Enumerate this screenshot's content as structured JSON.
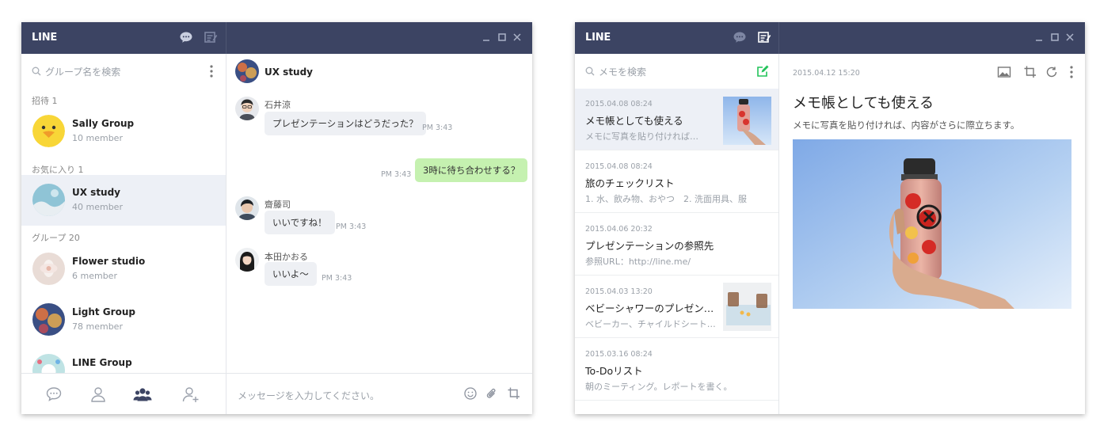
{
  "chat_window": {
    "logo": "LINE",
    "icons": [
      "chat-icon",
      "memo-icon",
      "minimize-icon",
      "maximize-icon",
      "close-icon"
    ],
    "search_placeholder": "グループ名を検索",
    "sections": {
      "invite": "招待 1",
      "favorites": "お気に入り 1",
      "groups": "グループ 20"
    },
    "friends": [
      {
        "name": "Sally Group",
        "sub": "10 member"
      },
      {
        "name": "UX study",
        "sub": "40 member"
      },
      {
        "name": "Flower studio",
        "sub": "6 member"
      },
      {
        "name": "Light Group",
        "sub": "78 member"
      },
      {
        "name": "LINE Group",
        "sub": ""
      }
    ],
    "chat_title": "UX study",
    "messages": [
      {
        "sender": "石井涼",
        "text": "プレゼンテーションはどうだった？",
        "time": "PM 3:43"
      },
      {
        "sender": "",
        "text": "3時に待ち合わせする？",
        "time": "PM 3:43"
      },
      {
        "sender": "齋藤司",
        "text": "いいですね！",
        "time": "PM 3:43"
      },
      {
        "sender": "本田かおる",
        "text": "いいよ〜",
        "time": "PM 3:43"
      }
    ],
    "input_placeholder": "メッセージを入力してください。",
    "accent": "#3c4463"
  },
  "memo_window": {
    "logo": "LINE",
    "search_placeholder": "メモを検索",
    "memos": [
      {
        "date": "2015.04.08  08:24",
        "title": "メモ帳としても使える",
        "sub": "メモに写真を貼り付ければ…"
      },
      {
        "date": "2015.04.08  08:24",
        "title": "旅のチェックリスト",
        "sub": "1. 水、飲み物、おやつ　2. 洗面用具、服"
      },
      {
        "date": "2015.04.06  20:32",
        "title": "プレゼンテーションの参照先",
        "sub": "参照URL：http://line.me/"
      },
      {
        "date": "2015.04.03  13:20",
        "title": "ベビーシャワーのプレゼン…",
        "sub": "ベビーカー、チャイルドシート…"
      },
      {
        "date": "2015.03.16  08:24",
        "title": "To-Doリスト",
        "sub": "朝のミーティング。レポートを書く。"
      }
    ],
    "detail": {
      "date": "2015.04.12  15:20",
      "title": "メモ帳としても使える",
      "body": "メモに写真を貼り付ければ、内容がさらに際立ちます。"
    },
    "new_memo_color": "#22c35a"
  }
}
